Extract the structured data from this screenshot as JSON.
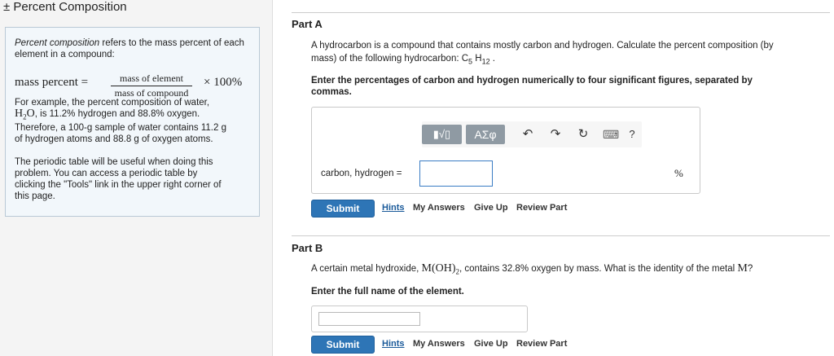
{
  "title": "± Percent Composition",
  "sidebar": {
    "intro_italic": "Percent composition",
    "intro_rest": " refers to the mass percent of each element in a compound:",
    "formula_lhs": "mass percent =",
    "formula_numerator": "mass of element",
    "formula_denominator": "mass of compound",
    "formula_times": "× 100%",
    "example_line1": "For example, the percent composition of water,",
    "example_formula_h": "H",
    "example_formula_sub": "2",
    "example_formula_o": "O",
    "example_mid": ", is 11.2% hydrogen and 88.8% oxygen.",
    "example_line3": "Therefore, a 100-g sample of water contains 11.2 g",
    "example_line4": "of hydrogen atoms and 88.8 g of oxygen atoms.",
    "periodic_line1": "The periodic table will be useful when doing this",
    "periodic_line2": "problem. You can access a periodic table by",
    "periodic_line3": "clicking the \"Tools\" link in the upper right corner of",
    "periodic_line4": "this page."
  },
  "part_a": {
    "title": "Part A",
    "question_line1": "A hydrocarbon is a compound that contains mostly carbon and hydrogen. Calculate the percent composition (by",
    "question_line2_prefix": "mass) of the following hydrocarbon: C",
    "question_sub1": "5",
    "question_h": " H",
    "question_sub2": "12",
    "question_end": " .",
    "instruction_line1": "Enter the percentages of carbon and hydrogen numerically to four significant figures, separated by",
    "instruction_line2": "commas.",
    "toolbar": {
      "template_label": "▮√▯",
      "symbols_label": "ΑΣφ",
      "undo_glyph": "↶",
      "redo_glyph": "↷",
      "reset_glyph": "↻",
      "keyboard_glyph": "⌨",
      "help_glyph": "?"
    },
    "field_label": "carbon, hydrogen =",
    "field_value": "",
    "unit": "%",
    "submit_label": "Submit",
    "hints_label": "Hints",
    "my_answers_label": "My Answers",
    "give_up_label": "Give Up",
    "review_label": "Review Part"
  },
  "part_b": {
    "title": "Part B",
    "question_prefix": "A certain metal hydroxide, ",
    "question_formula": "M(OH)",
    "question_formula_sub": "2",
    "question_mid": ", contains 32.8% oxygen by mass. What is the identity of the metal ",
    "question_metal": "M",
    "question_end": "?",
    "instruction": "Enter the full name of the element.",
    "field_value": "",
    "submit_label": "Submit",
    "hints_label": "Hints",
    "my_answers_label": "My Answers",
    "give_up_label": "Give Up",
    "review_label": "Review Part"
  },
  "colors": {
    "submit_blue": "#2e75b6",
    "info_box_bg": "#f2f7fb",
    "toolbar_button": "#8f9aa3",
    "link_blue": "#1a5a9a"
  }
}
